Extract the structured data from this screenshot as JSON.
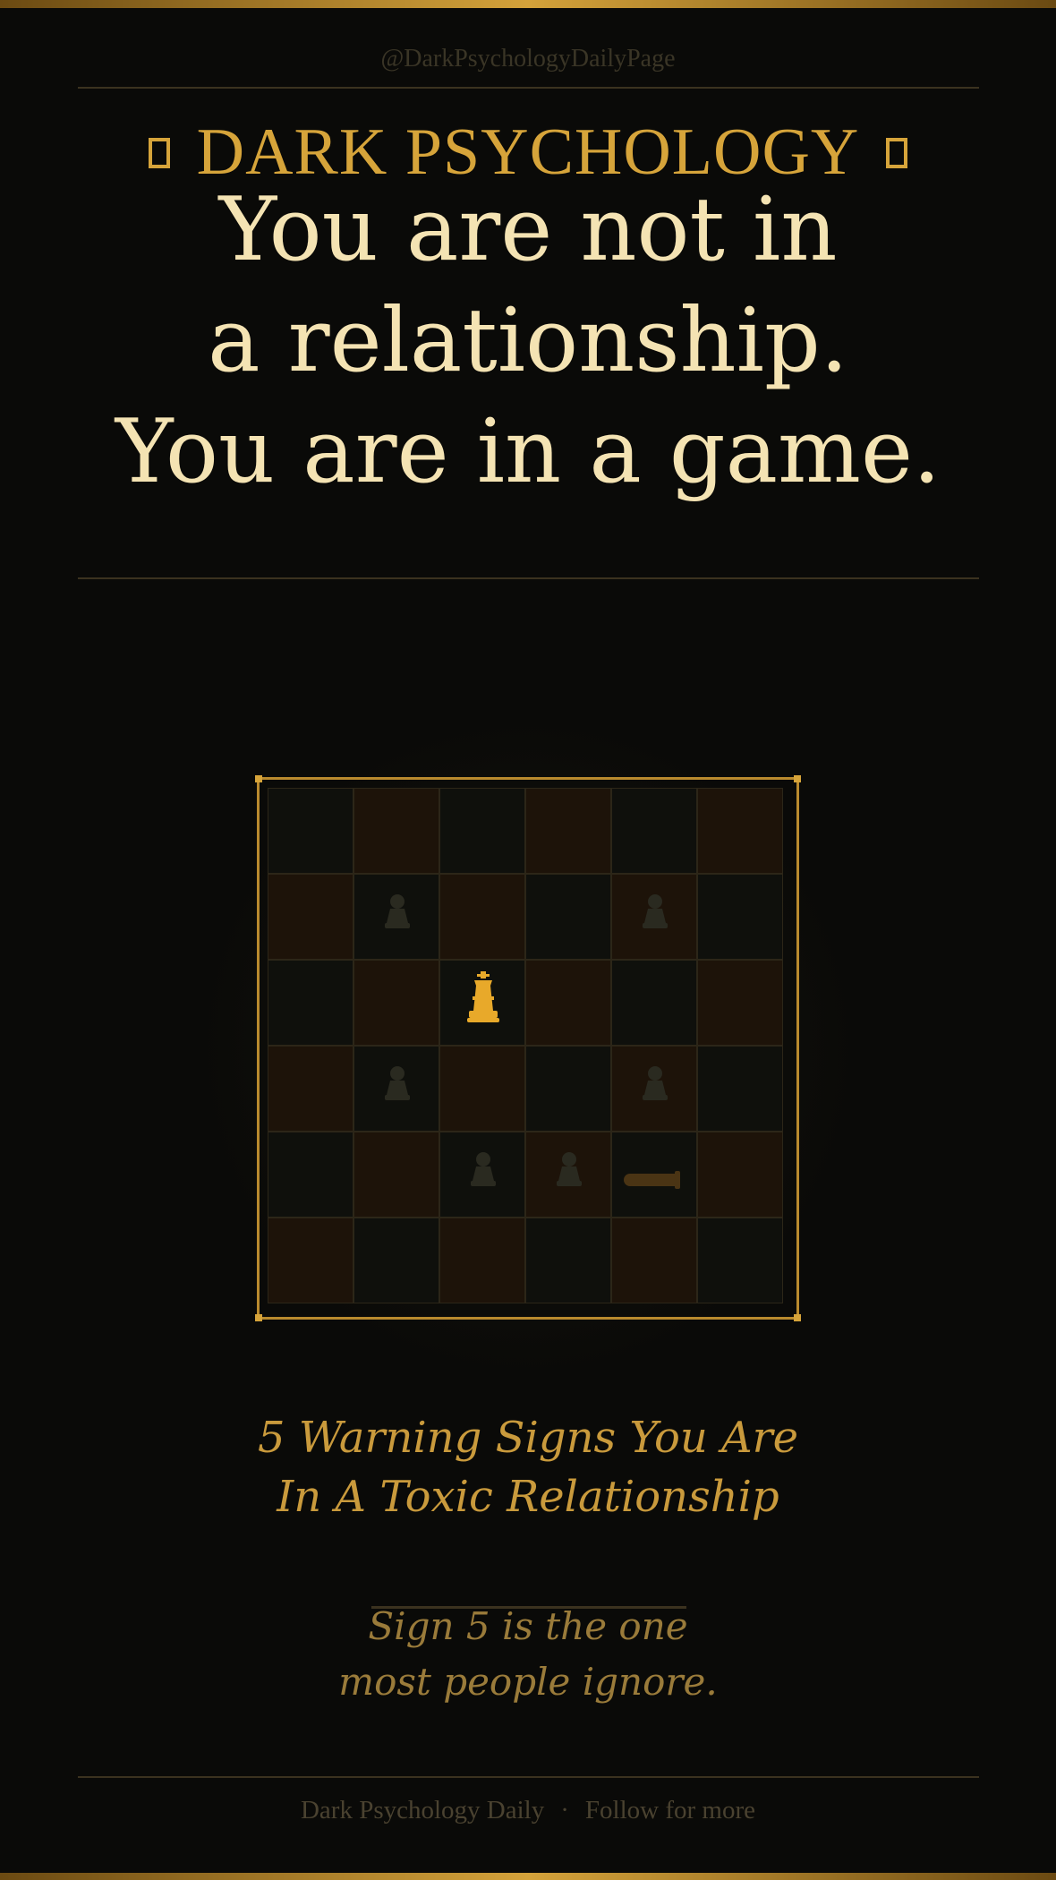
{
  "handle": "@DarkPsychologyDailyPage",
  "brand": {
    "title": "DARK PSYCHOLOGY"
  },
  "headline": {
    "line1": "You are not in",
    "line2": "a relationship.",
    "line3": "You are in a game."
  },
  "board": {
    "rows": 6,
    "cols": 6,
    "pieces": [
      {
        "type": "pawn",
        "row": 1,
        "col": 1,
        "state": "faded"
      },
      {
        "type": "pawn",
        "row": 1,
        "col": 4,
        "state": "faded"
      },
      {
        "type": "king",
        "row": 2,
        "col": 2,
        "state": "highlighted"
      },
      {
        "type": "pawn",
        "row": 3,
        "col": 1,
        "state": "faded"
      },
      {
        "type": "pawn",
        "row": 3,
        "col": 4,
        "state": "faded"
      },
      {
        "type": "pawn",
        "row": 4,
        "col": 2,
        "state": "faded"
      },
      {
        "type": "pawn",
        "row": 4,
        "col": 3,
        "state": "faded"
      },
      {
        "type": "fallen-piece",
        "row": 4,
        "col": 4,
        "state": "faded"
      }
    ],
    "colors": {
      "frame": "#b98a2e",
      "highlight": "#e8a92a",
      "faded_piece": "#2a2a20"
    }
  },
  "subtitle": {
    "line1": "5 Warning Signs You Are",
    "line2": "In A Toxic Relationship"
  },
  "teaser": {
    "line1": "Sign 5 is the one",
    "line2": "most people ignore."
  },
  "footer": {
    "name": "Dark Psychology Daily",
    "separator": "·",
    "cta": "Follow for more"
  },
  "colors": {
    "background": "#0a0a08",
    "gold": "#d6a43a",
    "cream": "#f4e3b3"
  }
}
